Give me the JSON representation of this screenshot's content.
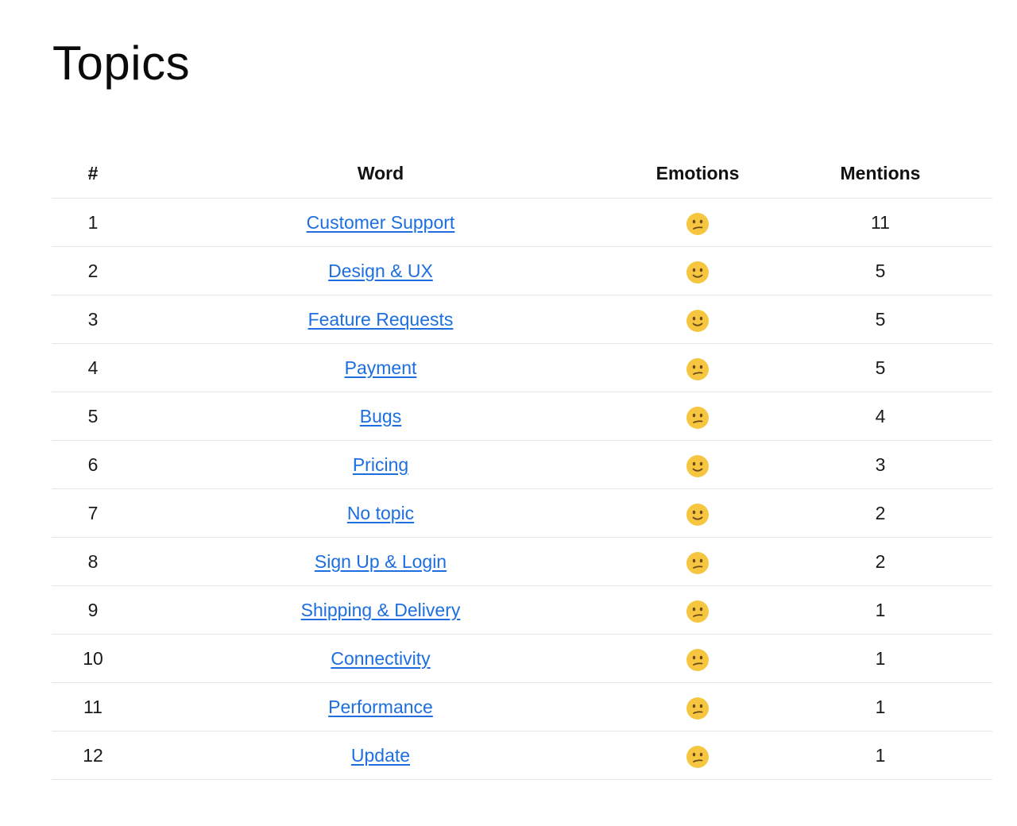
{
  "page": {
    "title": "Topics"
  },
  "table": {
    "headers": {
      "num": "#",
      "word": "Word",
      "emotions": "Emotions",
      "mentions": "Mentions"
    },
    "rows": [
      {
        "num": "1",
        "word": "Customer Support",
        "emotion": "confused",
        "mentions": "11"
      },
      {
        "num": "2",
        "word": "Design & UX",
        "emotion": "slight-smile",
        "mentions": "5"
      },
      {
        "num": "3",
        "word": "Feature Requests",
        "emotion": "slight-smile",
        "mentions": "5"
      },
      {
        "num": "4",
        "word": "Payment",
        "emotion": "confused",
        "mentions": "5"
      },
      {
        "num": "5",
        "word": "Bugs",
        "emotion": "confused",
        "mentions": "4"
      },
      {
        "num": "6",
        "word": "Pricing",
        "emotion": "slight-smile",
        "mentions": "3"
      },
      {
        "num": "7",
        "word": "No topic",
        "emotion": "slight-smile",
        "mentions": "2"
      },
      {
        "num": "8",
        "word": "Sign Up & Login",
        "emotion": "confused",
        "mentions": "2"
      },
      {
        "num": "9",
        "word": "Shipping & Delivery",
        "emotion": "confused",
        "mentions": "1"
      },
      {
        "num": "10",
        "word": "Connectivity",
        "emotion": "confused",
        "mentions": "1"
      },
      {
        "num": "11",
        "word": "Performance",
        "emotion": "confused",
        "mentions": "1"
      },
      {
        "num": "12",
        "word": "Update",
        "emotion": "confused",
        "mentions": "1"
      }
    ]
  },
  "colors": {
    "link": "#1d6fe0",
    "divider": "#e3e7ea",
    "emoji_face": "#f7c640",
    "emoji_features": "#6b4a18"
  }
}
